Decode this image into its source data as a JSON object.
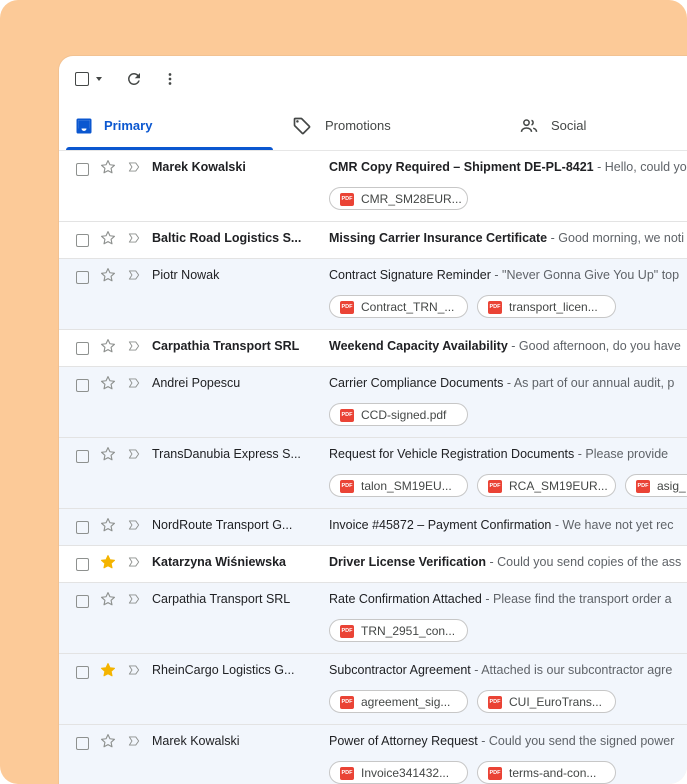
{
  "colors": {
    "background": "#fcca98",
    "accent": "#0b57d0",
    "read_row": "#f2f6fc",
    "star_filled": "#f4b400",
    "pdf": "#ea4335"
  },
  "toolbar": {
    "icons": [
      "select-all-checkbox",
      "select-dropdown-caret",
      "refresh-icon",
      "more-vertical-icon"
    ]
  },
  "tabs": [
    {
      "label": "Primary",
      "icon": "inbox-icon",
      "active": true
    },
    {
      "label": "Promotions",
      "icon": "tag-icon",
      "active": false
    },
    {
      "label": "Social",
      "icon": "people-icon",
      "active": false
    }
  ],
  "emails": [
    {
      "sender": "Marek Kowalski",
      "subject": "CMR Copy Required – Shipment DE-PL-8421",
      "snippet": "Hello, could you",
      "unread": true,
      "starred": false,
      "attachments": [
        "CMR_SM28EUR..."
      ]
    },
    {
      "sender": "Baltic Road Logistics S...",
      "subject": "Missing Carrier Insurance Certificate",
      "snippet": "Good morning, we noti",
      "unread": true,
      "starred": false,
      "attachments": []
    },
    {
      "sender": "Piotr Nowak",
      "subject": "Contract Signature Reminder",
      "snippet": "\"Never Gonna Give You Up\" top",
      "unread": false,
      "starred": false,
      "attachments": [
        "Contract_TRN_...",
        "transport_licen..."
      ]
    },
    {
      "sender": "Carpathia Transport SRL",
      "subject": "Weekend Capacity Availability",
      "snippet": "Good afternoon, do you have",
      "unread": true,
      "starred": false,
      "attachments": []
    },
    {
      "sender": "Andrei Popescu",
      "subject": "Carrier Compliance Documents",
      "snippet": "As part of our annual audit, p",
      "unread": false,
      "starred": false,
      "attachments": [
        "CCD-signed.pdf"
      ]
    },
    {
      "sender": "TransDanubia Express S...",
      "subject": "Request for Vehicle Registration Documents",
      "snippet": "Please provide",
      "unread": false,
      "starred": false,
      "attachments": [
        "talon_SM19EU...",
        "RCA_SM19EUR...",
        "asig_"
      ]
    },
    {
      "sender": "NordRoute Transport G...",
      "subject": "Invoice #45872 – Payment Confirmation",
      "snippet": "We have not yet rec",
      "unread": false,
      "starred": false,
      "attachments": []
    },
    {
      "sender": "Katarzyna Wiśniewska",
      "subject": "Driver License Verification",
      "snippet": "Could you send copies of the ass",
      "unread": true,
      "starred": true,
      "attachments": []
    },
    {
      "sender": "Carpathia Transport SRL",
      "subject": "Rate Confirmation Attached",
      "snippet": "Please find the transport order a",
      "unread": false,
      "starred": false,
      "attachments": [
        "TRN_2951_con..."
      ]
    },
    {
      "sender": "RheinCargo Logistics G...",
      "subject": "Subcontractor Agreement",
      "snippet": "Attached is our subcontractor agre",
      "unread": false,
      "starred": true,
      "attachments": [
        "agreement_sig...",
        "CUI_EuroTrans..."
      ]
    },
    {
      "sender": "Marek Kowalski",
      "subject": "Power of Attorney Request",
      "snippet": "Could you send the signed power",
      "unread": false,
      "starred": false,
      "attachments": [
        "Invoice341432...",
        "terms-and-con..."
      ]
    }
  ],
  "separator": "-",
  "pdf_badge": "PDF"
}
